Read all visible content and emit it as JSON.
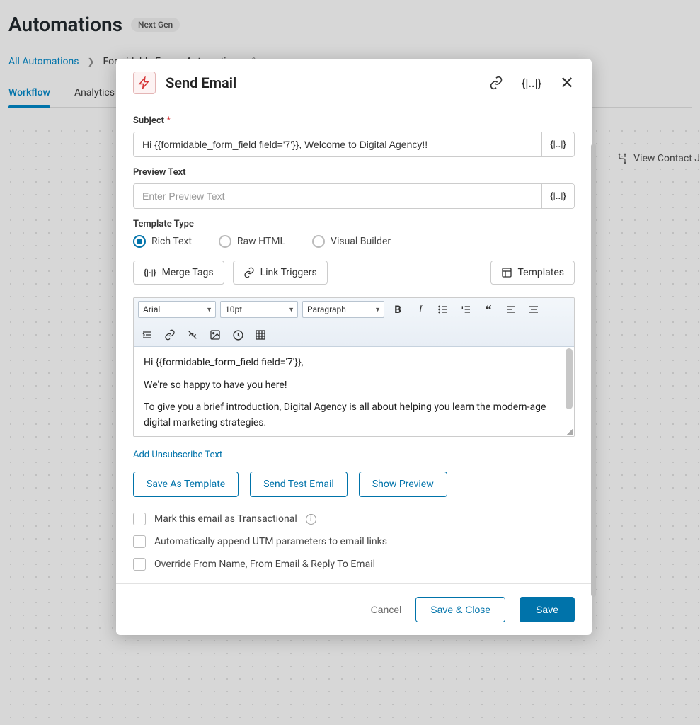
{
  "page": {
    "title": "Automations",
    "badge": "Next Gen",
    "view_contact": "View Contact J"
  },
  "breadcrumb": {
    "root": "All Automations",
    "current": "Formidable Forms Automation"
  },
  "tabs": [
    {
      "label": "Workflow",
      "active": true
    },
    {
      "label": "Analytics",
      "active": false
    }
  ],
  "modal": {
    "title": "Send Email",
    "icons": {
      "bolt": "bolt-icon",
      "link": "link-icon",
      "merge": "merge-tags-icon",
      "close": "close-icon"
    },
    "fields": {
      "subject": {
        "label": "Subject",
        "required": true,
        "value": "Hi {{formidable_form_field field='7'}}, Welcome to Digital Agency!!"
      },
      "preview": {
        "label": "Preview Text",
        "placeholder": "Enter Preview Text",
        "value": ""
      },
      "template_type": {
        "label": "Template Type",
        "options": [
          "Rich Text",
          "Raw HTML",
          "Visual Builder"
        ],
        "selected": "Rich Text"
      }
    },
    "toolbar_buttons": {
      "merge_tags": "Merge Tags",
      "link_triggers": "Link Triggers",
      "templates": "Templates"
    },
    "editor": {
      "font_family": "Arial",
      "font_size": "10pt",
      "block_format": "Paragraph",
      "content_lines": [
        "Hi {{formidable_form_field field='7'}},",
        "We're so happy to have you here!",
        "To give you a brief introduction, Digital Agency is all about helping you learn the modern-age digital marketing strategies."
      ]
    },
    "unsubscribe_link": "Add Unsubscribe Text",
    "action_buttons": {
      "save_template": "Save As Template",
      "send_test": "Send Test Email",
      "show_preview": "Show Preview"
    },
    "checkboxes": [
      {
        "label": "Mark this email as Transactional",
        "info": true,
        "checked": false
      },
      {
        "label": "Automatically append UTM parameters to email links",
        "info": false,
        "checked": false
      },
      {
        "label": "Override From Name, From Email & Reply To Email",
        "info": false,
        "checked": false
      }
    ],
    "footer": {
      "cancel": "Cancel",
      "save_close": "Save & Close",
      "save": "Save"
    }
  }
}
